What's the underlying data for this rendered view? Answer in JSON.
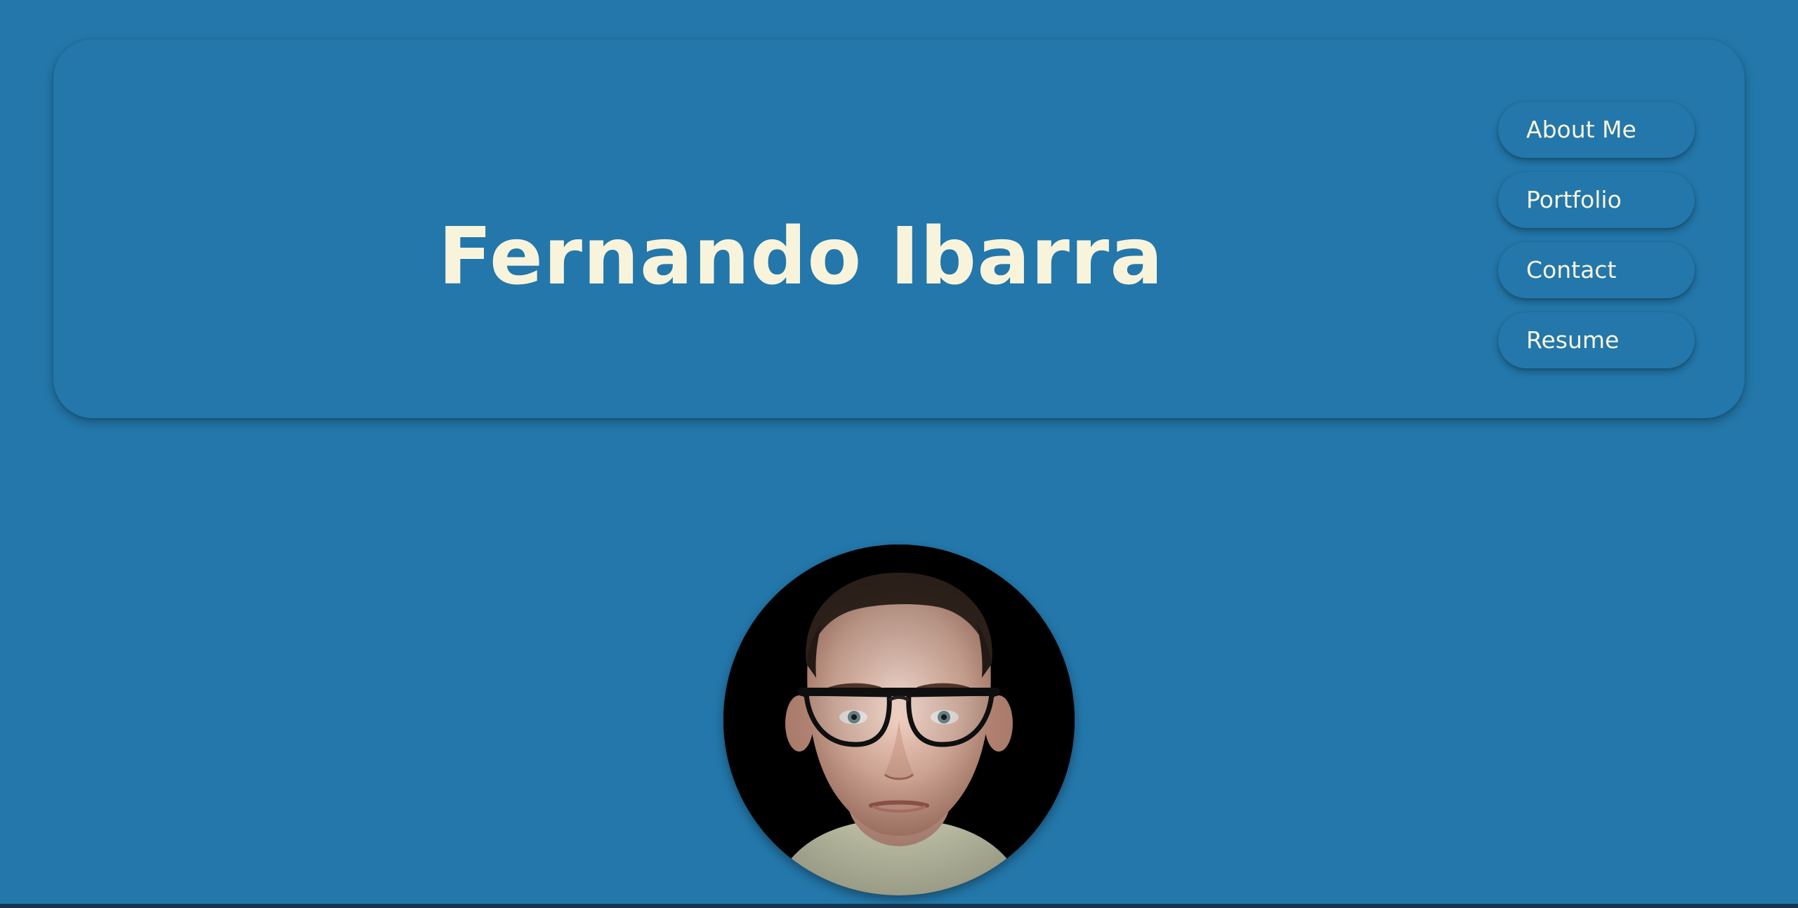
{
  "header": {
    "title": "Fernando Ibarra"
  },
  "nav": {
    "items": [
      {
        "label": "About Me"
      },
      {
        "label": "Portfolio"
      },
      {
        "label": "Contact"
      },
      {
        "label": "Resume"
      }
    ]
  },
  "profile": {
    "photo_icon": "portrait-photo"
  },
  "colors": {
    "background": "#2377aa",
    "title_text": "#f8f4dc",
    "nav_text": "#f8f4dc"
  }
}
